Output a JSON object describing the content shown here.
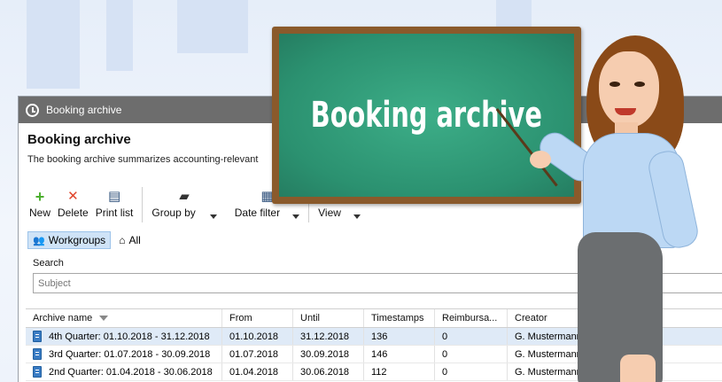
{
  "window": {
    "title": "Booking archive"
  },
  "header": {
    "title": "Booking archive",
    "description": "The booking archive summarizes accounting-relevant"
  },
  "board": {
    "title": "Booking archive"
  },
  "toolbar": {
    "new_label": "New",
    "delete_label": "Delete",
    "print_label": "Print list",
    "group_by_label": "Group by",
    "date_filter_label": "Date filter",
    "view_label": "View"
  },
  "workspace": {
    "workgroups_label": "Workgroups",
    "all_label": "All"
  },
  "search": {
    "label": "Search",
    "placeholder": "Subject"
  },
  "table": {
    "columns": [
      "Archive name",
      "From",
      "Until",
      "Timestamps",
      "Reimbursa...",
      "Creator"
    ],
    "rows": [
      [
        "4th Quarter: 01.10.2018 - 31.12.2018",
        "01.10.2018",
        "31.12.2018",
        "136",
        "0",
        "G. Mustermann ["
      ],
      [
        "3rd Quarter: 01.07.2018 - 30.09.2018",
        "01.07.2018",
        "30.09.2018",
        "146",
        "0",
        "G. Mustermann [9]"
      ],
      [
        "2nd Quarter: 01.04.2018 - 30.06.2018",
        "01.04.2018",
        "30.06.2018",
        "112",
        "0",
        "G. Mustermann [9]"
      ]
    ]
  },
  "colors": {
    "titlebar": "#6d6d6d",
    "board_green": "#2b9170",
    "board_frame": "#8a5a2b",
    "selection": "#dfeaf7",
    "accent_blue": "#3a7cc4"
  },
  "icons": {
    "new": "plus-icon",
    "delete": "x-icon",
    "print": "printer-icon",
    "group_by": "folder-icon",
    "date_filter": "calendar-icon",
    "workgroups": "people-icon",
    "all": "home-icon"
  }
}
